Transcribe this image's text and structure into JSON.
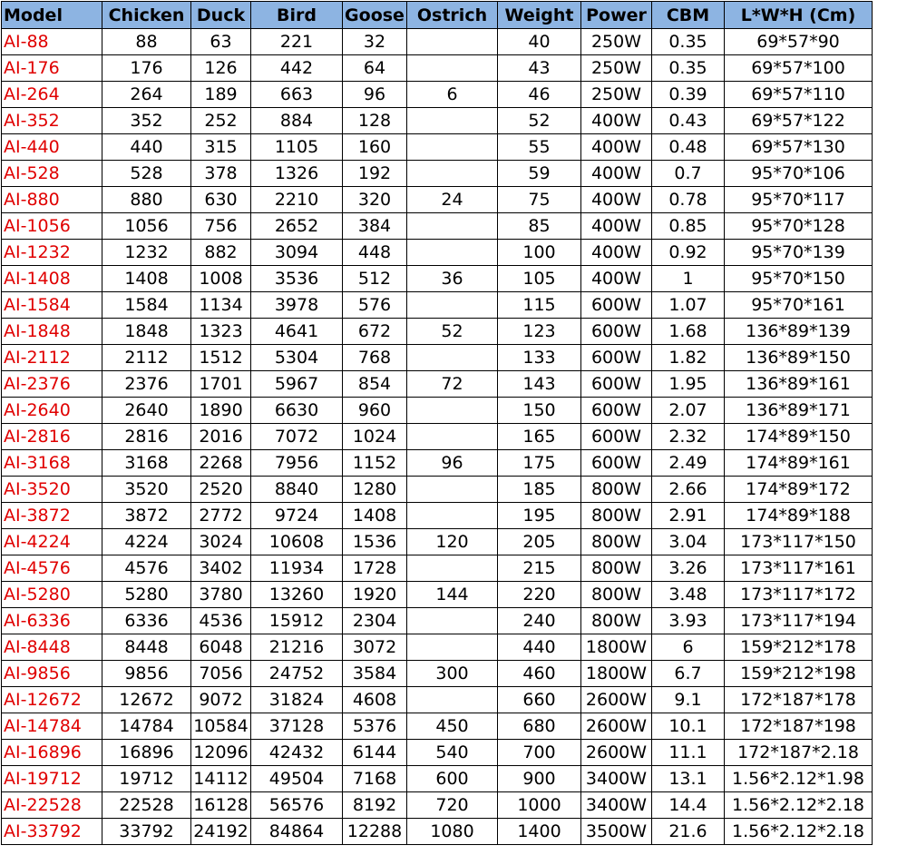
{
  "colors": {
    "header_bg": "#8db4e2",
    "model_text": "#e00000",
    "border": "#000000"
  },
  "columns": [
    "Model",
    "Chicken",
    "Duck",
    "Bird",
    "Goose",
    "Ostrich",
    "Weight",
    "Power",
    "CBM",
    "L*W*H (Cm)"
  ],
  "rows": [
    [
      "AI-88",
      "88",
      "63",
      "221",
      "32",
      "",
      "40",
      "250W",
      "0.35",
      "69*57*90"
    ],
    [
      "AI-176",
      "176",
      "126",
      "442",
      "64",
      "",
      "43",
      "250W",
      "0.35",
      "69*57*100"
    ],
    [
      "AI-264",
      "264",
      "189",
      "663",
      "96",
      "6",
      "46",
      "250W",
      "0.39",
      "69*57*110"
    ],
    [
      "AI-352",
      "352",
      "252",
      "884",
      "128",
      "",
      "52",
      "400W",
      "0.43",
      "69*57*122"
    ],
    [
      "AI-440",
      "440",
      "315",
      "1105",
      "160",
      "",
      "55",
      "400W",
      "0.48",
      "69*57*130"
    ],
    [
      "AI-528",
      "528",
      "378",
      "1326",
      "192",
      "",
      "59",
      "400W",
      "0.7",
      "95*70*106"
    ],
    [
      "AI-880",
      "880",
      "630",
      "2210",
      "320",
      "24",
      "75",
      "400W",
      "0.78",
      "95*70*117"
    ],
    [
      "AI-1056",
      "1056",
      "756",
      "2652",
      "384",
      "",
      "85",
      "400W",
      "0.85",
      "95*70*128"
    ],
    [
      "AI-1232",
      "1232",
      "882",
      "3094",
      "448",
      "",
      "100",
      "400W",
      "0.92",
      "95*70*139"
    ],
    [
      "AI-1408",
      "1408",
      "1008",
      "3536",
      "512",
      "36",
      "105",
      "400W",
      "1",
      "95*70*150"
    ],
    [
      "AI-1584",
      "1584",
      "1134",
      "3978",
      "576",
      "",
      "115",
      "600W",
      "1.07",
      "95*70*161"
    ],
    [
      "AI-1848",
      "1848",
      "1323",
      "4641",
      "672",
      "52",
      "123",
      "600W",
      "1.68",
      "136*89*139"
    ],
    [
      "AI-2112",
      "2112",
      "1512",
      "5304",
      "768",
      "",
      "133",
      "600W",
      "1.82",
      "136*89*150"
    ],
    [
      "AI-2376",
      "2376",
      "1701",
      "5967",
      "854",
      "72",
      "143",
      "600W",
      "1.95",
      "136*89*161"
    ],
    [
      "AI-2640",
      "2640",
      "1890",
      "6630",
      "960",
      "",
      "150",
      "600W",
      "2.07",
      "136*89*171"
    ],
    [
      "AI-2816",
      "2816",
      "2016",
      "7072",
      "1024",
      "",
      "165",
      "600W",
      "2.32",
      "174*89*150"
    ],
    [
      "AI-3168",
      "3168",
      "2268",
      "7956",
      "1152",
      "96",
      "175",
      "600W",
      "2.49",
      "174*89*161"
    ],
    [
      "AI-3520",
      "3520",
      "2520",
      "8840",
      "1280",
      "",
      "185",
      "800W",
      "2.66",
      "174*89*172"
    ],
    [
      "AI-3872",
      "3872",
      "2772",
      "9724",
      "1408",
      "",
      "195",
      "800W",
      "2.91",
      "174*89*188"
    ],
    [
      "AI-4224",
      "4224",
      "3024",
      "10608",
      "1536",
      "120",
      "205",
      "800W",
      "3.04",
      "173*117*150"
    ],
    [
      "AI-4576",
      "4576",
      "3402",
      "11934",
      "1728",
      "",
      "215",
      "800W",
      "3.26",
      "173*117*161"
    ],
    [
      "AI-5280",
      "5280",
      "3780",
      "13260",
      "1920",
      "144",
      "220",
      "800W",
      "3.48",
      "173*117*172"
    ],
    [
      "AI-6336",
      "6336",
      "4536",
      "15912",
      "2304",
      "",
      "240",
      "800W",
      "3.93",
      "173*117*194"
    ],
    [
      "AI-8448",
      "8448",
      "6048",
      "21216",
      "3072",
      "",
      "440",
      "1800W",
      "6",
      "159*212*178"
    ],
    [
      "AI-9856",
      "9856",
      "7056",
      "24752",
      "3584",
      "300",
      "460",
      "1800W",
      "6.7",
      "159*212*198"
    ],
    [
      "AI-12672",
      "12672",
      "9072",
      "31824",
      "4608",
      "",
      "660",
      "2600W",
      "9.1",
      "172*187*178"
    ],
    [
      "AI-14784",
      "14784",
      "10584",
      "37128",
      "5376",
      "450",
      "680",
      "2600W",
      "10.1",
      "172*187*198"
    ],
    [
      "AI-16896",
      "16896",
      "12096",
      "42432",
      "6144",
      "540",
      "700",
      "2600W",
      "11.1",
      "172*187*2.18"
    ],
    [
      "AI-19712",
      "19712",
      "14112",
      "49504",
      "7168",
      "600",
      "900",
      "3400W",
      "13.1",
      "1.56*2.12*1.98"
    ],
    [
      "AI-22528",
      "22528",
      "16128",
      "56576",
      "8192",
      "720",
      "1000",
      "3400W",
      "14.4",
      "1.56*2.12*2.18"
    ],
    [
      "AI-33792",
      "33792",
      "24192",
      "84864",
      "12288",
      "1080",
      "1400",
      "3500W",
      "21.6",
      "1.56*2.12*2.18"
    ]
  ]
}
